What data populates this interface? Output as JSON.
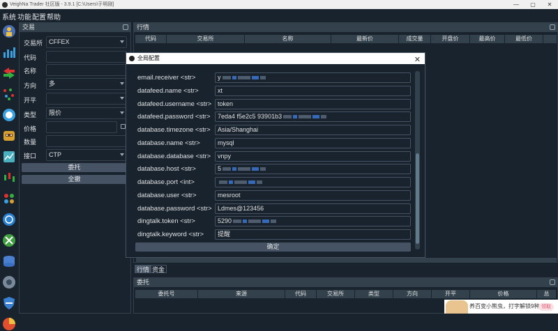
{
  "window": {
    "title": "VeighNa Trader 社区版 - 3.9.1   [C:\\Users\\于明刚]",
    "controls": [
      "minimize",
      "maximize",
      "close"
    ]
  },
  "menu": [
    "系统",
    "功能",
    "配置",
    "帮助"
  ],
  "toolbar_icons": [
    "trader-icon",
    "chart-icon",
    "arrows-icon",
    "scatter-icon",
    "circle-icon",
    "robot-icon",
    "backtest-icon",
    "candles-icon",
    "spread-icon",
    "swap-icon",
    "database-icon",
    "recorder-icon",
    "shield-icon",
    "pie-icon"
  ],
  "trading": {
    "title": "交易",
    "labels": {
      "exchange": "交易所",
      "symbol": "代码",
      "name": "名称",
      "direction": "方向",
      "offset": "开平",
      "type": "类型",
      "price": "价格",
      "volume": "数量",
      "gateway": "接口"
    },
    "values": {
      "exchange": "CFFEX",
      "direction": "多",
      "type": "限价",
      "gateway": "CTP"
    },
    "buttons": {
      "send": "委托",
      "cancel_all": "全撤"
    }
  },
  "market": {
    "title": "行情",
    "columns": [
      "代码",
      "交易所",
      "名称",
      "最新价",
      "成交量",
      "开盘价",
      "最高价",
      "最低价"
    ]
  },
  "bottom_tabs": [
    "行情",
    "资金"
  ],
  "orders": {
    "title": "委托",
    "columns": [
      "委托号",
      "来源",
      "代码",
      "交易所",
      "类型",
      "方向",
      "开平",
      "价格",
      "总"
    ]
  },
  "dialog": {
    "title": "全局配置",
    "close": "✕",
    "rows": [
      {
        "label": "email.receiver <str>",
        "value": "y",
        "blurred": true
      },
      {
        "label": "datafeed.name <str>",
        "value": "xt"
      },
      {
        "label": "datafeed.username <str>",
        "value": "token"
      },
      {
        "label": "datafeed.password <str>",
        "value": "7eda4     f5e2c5      93901b3",
        "blurred": true
      },
      {
        "label": "database.timezone <str>",
        "value": "Asia/Shanghai"
      },
      {
        "label": "database.name <str>",
        "value": "mysql"
      },
      {
        "label": "database.database <str>",
        "value": "vnpy"
      },
      {
        "label": "database.host <str>",
        "value": "5",
        "blurred": true
      },
      {
        "label": "database.port <int>",
        "value": "",
        "blurred": true
      },
      {
        "label": "database.user <str>",
        "value": "mesroot"
      },
      {
        "label": "database.password <str>",
        "value": "Ldmes@123456"
      },
      {
        "label": "dingtalk.token <str>",
        "value": "5290",
        "blurred": true
      },
      {
        "label": "dingtalk.keyword <str>",
        "value": "提醒"
      }
    ],
    "ok": "确定"
  },
  "notification": {
    "text": "养百变小熊虫，打字解锁9种x",
    "button": "领取"
  },
  "colors": {
    "bg": "#19232d",
    "panel": "#32414b",
    "button": "#455364",
    "text": "#e0e1e3"
  }
}
